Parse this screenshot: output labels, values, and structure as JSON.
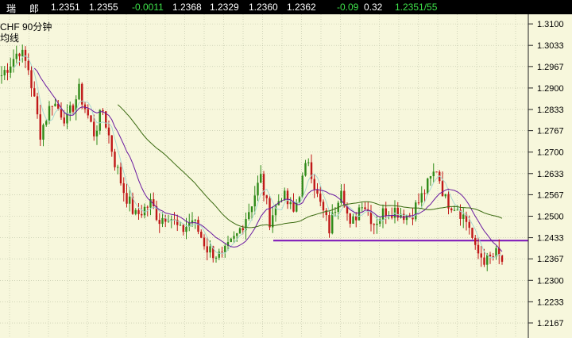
{
  "header": {
    "symbol": "瑞",
    "name": "郎",
    "open": "1.2351",
    "prev": "1.2355",
    "change": "-0.0011",
    "high": "1.2368",
    "low": "1.2329",
    "v3": "1.2360",
    "v4": "1.2362",
    "pct": "-0.09",
    "v5": "0.32",
    "bidask": "1.2351/55"
  },
  "chart_labels": {
    "period": "CHF   90分钟",
    "indicator": "均线"
  },
  "colors": {
    "background": "#f7f7dc",
    "grid": "#b9bfa3",
    "up": "#2f8a18",
    "down": "#c01818",
    "ma_short": "#a8d8d0",
    "ma_mid": "#6a1aa0",
    "ma_long": "#3a6a10",
    "support": "#7a10b8"
  },
  "chart_data": {
    "type": "candlestick",
    "ylim": [
      1.212,
      1.313
    ],
    "yticks": [
      "1.3100",
      "1.3033",
      "1.2967",
      "1.2900",
      "1.2833",
      "1.2767",
      "1.2700",
      "1.2633",
      "1.2567",
      "1.2500",
      "1.2433",
      "1.2367",
      "1.2300",
      "1.2233",
      "1.2167"
    ],
    "support_level": 1.2424,
    "anchors": [
      [
        0,
        1.294
      ],
      [
        6,
        1.302
      ],
      [
        9,
        1.296
      ],
      [
        13,
        1.276
      ],
      [
        17,
        1.286
      ],
      [
        22,
        1.28
      ],
      [
        26,
        1.289
      ],
      [
        31,
        1.276
      ],
      [
        34,
        1.283
      ],
      [
        38,
        1.267
      ],
      [
        41,
        1.258
      ],
      [
        45,
        1.25
      ],
      [
        50,
        1.254
      ],
      [
        53,
        1.249
      ],
      [
        56,
        1.251
      ],
      [
        60,
        1.245
      ],
      [
        64,
        1.249
      ],
      [
        69,
        1.24
      ],
      [
        74,
        1.237
      ],
      [
        79,
        1.244
      ],
      [
        83,
        1.252
      ],
      [
        87,
        1.262
      ],
      [
        90,
        1.249
      ],
      [
        94,
        1.257
      ],
      [
        98,
        1.251
      ],
      [
        103,
        1.268
      ],
      [
        106,
        1.256
      ],
      [
        110,
        1.246
      ],
      [
        114,
        1.26
      ],
      [
        117,
        1.246
      ],
      [
        121,
        1.255
      ],
      [
        125,
        1.248
      ],
      [
        129,
        1.252
      ],
      [
        132,
        1.252
      ],
      [
        137,
        1.25
      ],
      [
        141,
        1.256
      ],
      [
        146,
        1.265
      ],
      [
        149,
        1.255
      ],
      [
        153,
        1.253
      ],
      [
        157,
        1.247
      ],
      [
        159,
        1.239
      ],
      [
        163,
        1.236
      ],
      [
        166,
        1.238
      ],
      [
        168,
        1.236
      ]
    ],
    "ma_short_period": 5,
    "ma_mid_period": 12,
    "ma_long_period": 40
  }
}
